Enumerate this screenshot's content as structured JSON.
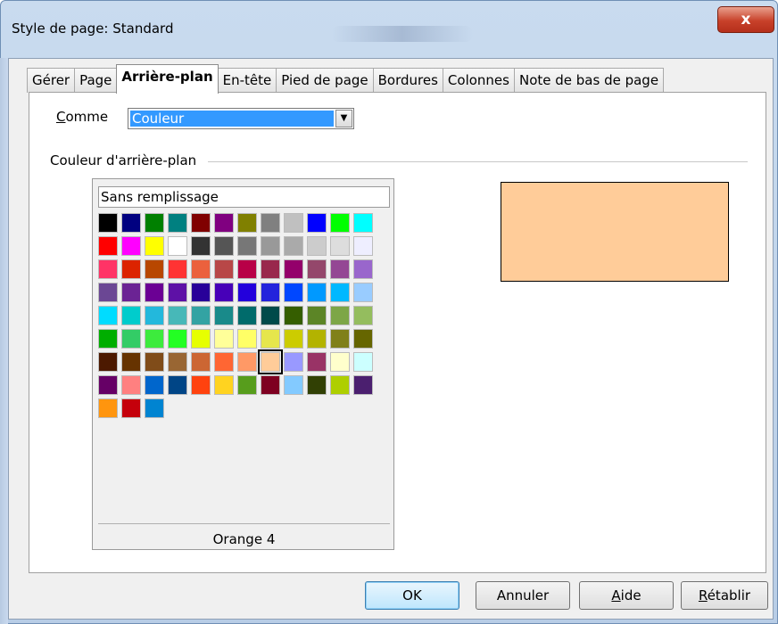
{
  "window": {
    "title": "Style de page: Standard",
    "close_label": "x"
  },
  "tabs": [
    {
      "label": "Gérer",
      "active": false
    },
    {
      "label": "Page",
      "active": false
    },
    {
      "label": "Arrière-plan",
      "active": true
    },
    {
      "label": "En-tête",
      "active": false
    },
    {
      "label": "Pied de page",
      "active": false
    },
    {
      "label": "Bordures",
      "active": false
    },
    {
      "label": "Colonnes",
      "active": false
    },
    {
      "label": "Note de bas de page",
      "active": false
    }
  ],
  "form": {
    "comme_label": "Comme",
    "comme_accel": "C",
    "comme_rest": "omme",
    "comme_value": "Couleur",
    "section_label": "Couleur d'arrière-plan"
  },
  "palette": {
    "none_label": "Sans remplissage",
    "selected_name": "Orange 4",
    "selected_color": "#ffcc99",
    "colors": [
      "#000000",
      "#000080",
      "#008000",
      "#008080",
      "#800000",
      "#800080",
      "#808000",
      "#808080",
      "#c0c0c0",
      "#0000ff",
      "#00ff00",
      "#00ffff",
      "#ff0000",
      "#ff00ff",
      "#ffff00",
      "#ffffff",
      "#333333",
      "#555555",
      "#777777",
      "#999999",
      "#aaaaaa",
      "#cccccc",
      "#dddddd",
      "#eeeeff",
      "#ff3366",
      "#dc2300",
      "#b84700",
      "#ff3333",
      "#eb613d",
      "#b84747",
      "#b80047",
      "#99284c",
      "#94006b",
      "#94476b",
      "#944794",
      "#9966cc",
      "#6b4794",
      "#6b2394",
      "#6b0094",
      "#5e11a6",
      "#280099",
      "#4700b8",
      "#2300dc",
      "#2323dc",
      "#0047ff",
      "#0099ff",
      "#00b8ff",
      "#99ccff",
      "#00dcff",
      "#00cccc",
      "#23b8dc",
      "#47b8b8",
      "#33a3a3",
      "#198a8a",
      "#006b6b",
      "#004a4a",
      "#355e00",
      "#5c8526",
      "#7da647",
      "#94bd5e",
      "#00ae00",
      "#33cc66",
      "#3deb3d",
      "#23ff23",
      "#e6ff00",
      "#ffff99",
      "#ffff66",
      "#e6e64c",
      "#cccc00",
      "#b3b300",
      "#808019",
      "#666600",
      "#4c1900",
      "#663300",
      "#804c19",
      "#996633",
      "#cc6633",
      "#ff6633",
      "#ff9966",
      "#ffcc99",
      "#9999ff",
      "#993366",
      "#ffffcc",
      "#ccffff",
      "#660066",
      "#ff8080",
      "#0066cc",
      "#004586",
      "#ff420e",
      "#ffd320",
      "#579d1c",
      "#7e0021",
      "#83caff",
      "#314004",
      "#aecf00",
      "#4b1f6f",
      "#ff950e",
      "#c5000b",
      "#0084d1"
    ],
    "selected_index": 79
  },
  "buttons": {
    "ok": "OK",
    "cancel": "Annuler",
    "help_accel": "A",
    "help_rest": "ide",
    "reset_accel": "R",
    "reset_rest": "établir"
  }
}
